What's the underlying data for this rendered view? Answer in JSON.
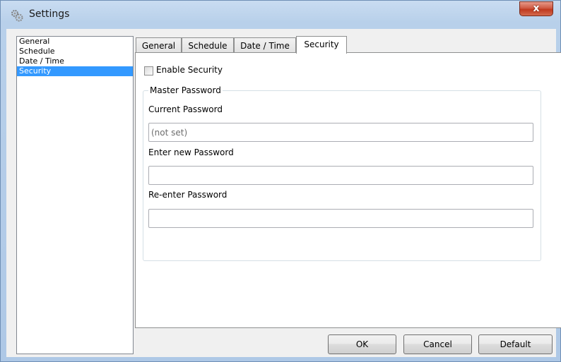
{
  "window": {
    "title": "Settings",
    "close_symbol": "x",
    "icon": "settings-gears-icon"
  },
  "sidebar": {
    "items": [
      {
        "label": "General",
        "selected": false
      },
      {
        "label": "Schedule",
        "selected": false
      },
      {
        "label": "Date / Time",
        "selected": false
      },
      {
        "label": "Security",
        "selected": true
      }
    ]
  },
  "tabs": [
    {
      "label": "General",
      "active": false
    },
    {
      "label": "Schedule",
      "active": false
    },
    {
      "label": "Date / Time",
      "active": false
    },
    {
      "label": "Security",
      "active": true
    }
  ],
  "security": {
    "enable_label": "Enable Security",
    "enable_checked": false,
    "group_title": "Master Password",
    "current_label": "Current Password",
    "current_placeholder": "(not set)",
    "current_value": "",
    "new_label": "Enter new Password",
    "new_value": "",
    "reenter_label": "Re-enter Password",
    "reenter_value": ""
  },
  "buttons": {
    "ok": "OK",
    "cancel": "Cancel",
    "default": "Default"
  },
  "colors": {
    "selection": "#3399ff",
    "close_button": "#c0391e"
  }
}
